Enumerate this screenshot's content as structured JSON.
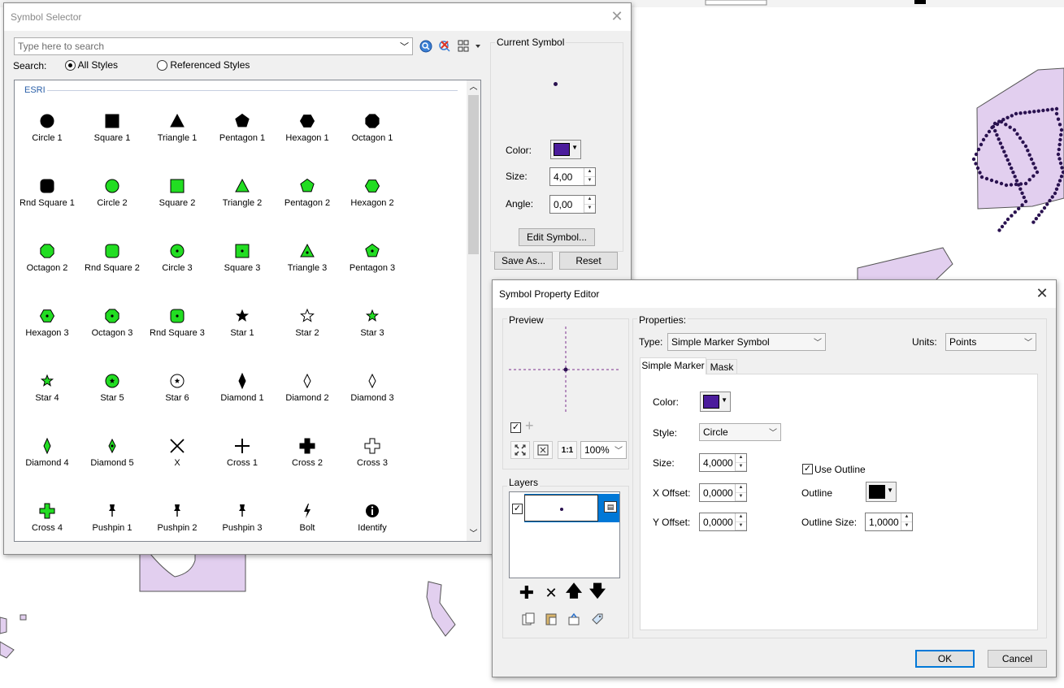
{
  "symbol_selector": {
    "title": "Symbol Selector",
    "search_placeholder": "Type here to search",
    "search_label": "Search:",
    "radio_all": "All Styles",
    "radio_referenced": "Referenced Styles",
    "style_group": "ESRI",
    "symbols": [
      {
        "name": "Circle 1",
        "shape": "circle",
        "fill": "#000000"
      },
      {
        "name": "Square 1",
        "shape": "square",
        "fill": "#000000"
      },
      {
        "name": "Triangle 1",
        "shape": "triangle",
        "fill": "#000000"
      },
      {
        "name": "Pentagon 1",
        "shape": "pentagon",
        "fill": "#000000"
      },
      {
        "name": "Hexagon 1",
        "shape": "hexagon",
        "fill": "#000000"
      },
      {
        "name": "Octagon 1",
        "shape": "octagon",
        "fill": "#000000"
      },
      {
        "name": "Rnd Square 1",
        "shape": "rndsquare",
        "fill": "#000000"
      },
      {
        "name": "Circle 2",
        "shape": "circle",
        "fill": "#22dd22"
      },
      {
        "name": "Square 2",
        "shape": "square",
        "fill": "#22dd22"
      },
      {
        "name": "Triangle 2",
        "shape": "triangle",
        "fill": "#22dd22"
      },
      {
        "name": "Pentagon 2",
        "shape": "pentagon",
        "fill": "#22dd22"
      },
      {
        "name": "Hexagon 2",
        "shape": "hexagon",
        "fill": "#22dd22"
      },
      {
        "name": "Octagon 2",
        "shape": "octagon",
        "fill": "#22dd22"
      },
      {
        "name": "Rnd Square 2",
        "shape": "rndsquare",
        "fill": "#22dd22"
      },
      {
        "name": "Circle 3",
        "shape": "circle-dot",
        "fill": "#22dd22"
      },
      {
        "name": "Square 3",
        "shape": "square-dot",
        "fill": "#22dd22"
      },
      {
        "name": "Triangle 3",
        "shape": "triangle-dot",
        "fill": "#22dd22"
      },
      {
        "name": "Pentagon 3",
        "shape": "pentagon-dot",
        "fill": "#22dd22"
      },
      {
        "name": "Hexagon 3",
        "shape": "hexagon-dot",
        "fill": "#22dd22"
      },
      {
        "name": "Octagon 3",
        "shape": "octagon-dot",
        "fill": "#22dd22"
      },
      {
        "name": "Rnd Square 3",
        "shape": "rndsquare-dot",
        "fill": "#22dd22"
      },
      {
        "name": "Star 1",
        "shape": "star",
        "fill": "#000000"
      },
      {
        "name": "Star 2",
        "shape": "star-outline",
        "fill": "#ffffff"
      },
      {
        "name": "Star 3",
        "shape": "star",
        "fill": "#22dd22"
      },
      {
        "name": "Star 4",
        "shape": "star",
        "fill": "#22dd22"
      },
      {
        "name": "Star 5",
        "shape": "circle-star",
        "fill": "#22dd22"
      },
      {
        "name": "Star 6",
        "shape": "circle-star-outline",
        "fill": "#ffffff"
      },
      {
        "name": "Diamond 1",
        "shape": "diamond",
        "fill": "#000000"
      },
      {
        "name": "Diamond 2",
        "shape": "diamond-outline",
        "fill": "#ffffff"
      },
      {
        "name": "Diamond 3",
        "shape": "diamond-outline",
        "fill": "#ffffff"
      },
      {
        "name": "Diamond 4",
        "shape": "diamond",
        "fill": "#22dd22"
      },
      {
        "name": "Diamond 5",
        "shape": "diamond-dot",
        "fill": "#22dd22"
      },
      {
        "name": "X",
        "shape": "x",
        "fill": "#000000"
      },
      {
        "name": "Cross 1",
        "shape": "cross-thin",
        "fill": "#000000"
      },
      {
        "name": "Cross 2",
        "shape": "cross-bold",
        "fill": "#000000"
      },
      {
        "name": "Cross 3",
        "shape": "cross-outline",
        "fill": "#ffffff"
      },
      {
        "name": "Cross 4",
        "shape": "cross-bold",
        "fill": "#22dd22"
      },
      {
        "name": "Pushpin 1",
        "shape": "pushpin",
        "fill": "#000000"
      },
      {
        "name": "Pushpin 2",
        "shape": "pushpin",
        "fill": "#000000"
      },
      {
        "name": "Pushpin 3",
        "shape": "pushpin",
        "fill": "#000000"
      },
      {
        "name": "Bolt",
        "shape": "bolt",
        "fill": "#000000"
      },
      {
        "name": "Identify",
        "shape": "identify",
        "fill": "#000000"
      }
    ],
    "current_symbol_label": "Current Symbol",
    "color_label": "Color:",
    "color_value": "#4b1c9c",
    "size_label": "Size:",
    "size_value": "4,00",
    "angle_label": "Angle:",
    "angle_value": "0,00",
    "edit_symbol_label": "Edit Symbol...",
    "save_as_label": "Save As...",
    "reset_label": "Reset"
  },
  "property_editor": {
    "title": "Symbol Property Editor",
    "preview_label": "Preview",
    "zoom_value": "100%",
    "layers_label": "Layers",
    "properties_label": "Properties:",
    "type_label": "Type:",
    "type_value": "Simple Marker Symbol",
    "units_label": "Units:",
    "units_value": "Points",
    "tab_simple_marker": "Simple Marker",
    "tab_mask": "Mask",
    "color_label": "Color:",
    "color_value": "#4b1c9c",
    "style_label": "Style:",
    "style_value": "Circle",
    "size_label": "Size:",
    "size_value": "4,0000",
    "x_offset_label": "X Offset:",
    "x_offset_value": "0,0000",
    "y_offset_label": "Y Offset:",
    "y_offset_value": "0,0000",
    "use_outline_label": "Use Outline",
    "outline_label": "Outline",
    "outline_color": "#000000",
    "outline_size_label": "Outline Size:",
    "outline_size_value": "1,0000",
    "ok_label": "OK",
    "cancel_label": "Cancel"
  },
  "map": {
    "polygon_fill": "#e2cfef",
    "polygon_stroke": "#555555",
    "point_color": "#2a1250"
  }
}
